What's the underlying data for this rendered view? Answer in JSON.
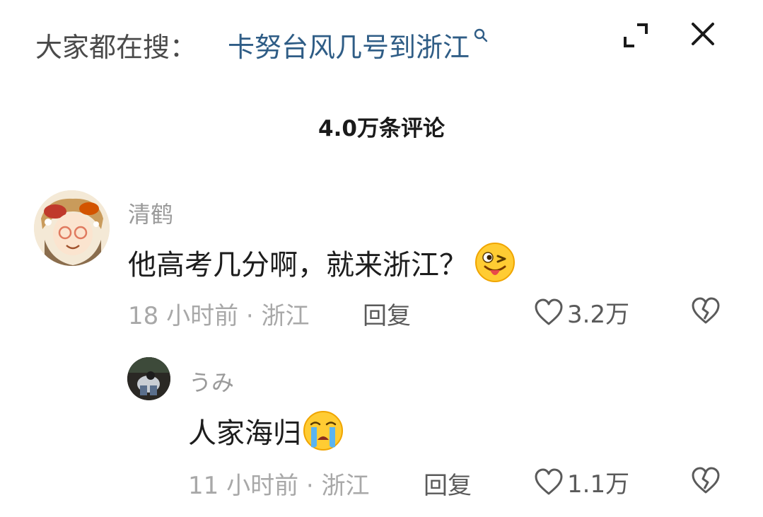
{
  "header": {
    "search_prefix": "大家都在搜：",
    "search_query": "卡努台风几号到浙江"
  },
  "icons": {
    "search": "search-icon",
    "expand": "expand-icon",
    "close": "close-icon",
    "like": "heart-outline-icon",
    "dislike": "broken-heart-icon"
  },
  "comment_count": "4.0万条评论",
  "comments": [
    {
      "username": "清鹤",
      "text": "他高考几分啊，就来浙江？",
      "emoji": "winking-tongue-emoji",
      "meta": "18 小时前 · 浙江",
      "reply_label": "回复",
      "likes": "3.2万"
    },
    {
      "username": "うみ",
      "text": "人家海归",
      "emoji": "crying-emoji",
      "meta": "11 小时前 · 浙江",
      "reply_label": "回复",
      "likes": "1.1万"
    }
  ],
  "colors": {
    "query_link": "#2f5d86",
    "secondary_text": "#a8a8a8",
    "primary_text": "#1d1d1d"
  }
}
